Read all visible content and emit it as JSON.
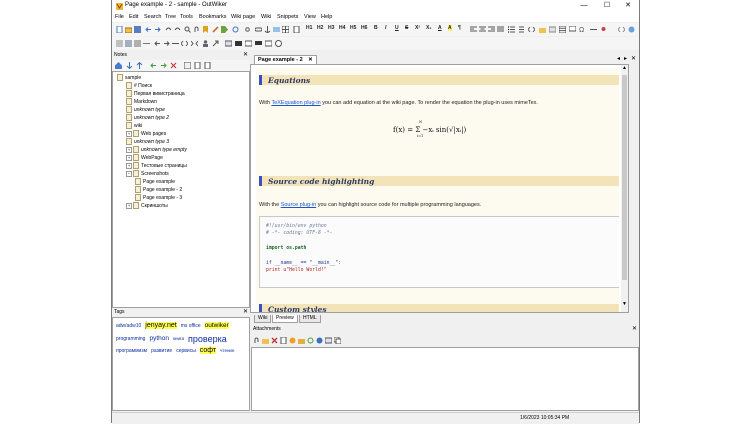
{
  "window": {
    "title": "Page example - 2 - sample - OutWiker",
    "buttons": [
      "—",
      "☐",
      "✕"
    ]
  },
  "menu": [
    "File",
    "Edit",
    "Search",
    "Tree",
    "Tools",
    "Bookmarks",
    "Wiki page",
    "Wiki",
    "Snippets",
    "View",
    "Help"
  ],
  "toolbar": {
    "format_buttons": [
      "H1",
      "H2",
      "H3",
      "H4",
      "H5",
      "H6",
      "B",
      "I",
      "U",
      "S",
      "X²",
      "X₂",
      "A",
      "A",
      "¶"
    ]
  },
  "notes_panel": {
    "title": "Notes",
    "tree": [
      {
        "label": "sample",
        "level": 0,
        "italic": false,
        "expander": ""
      },
      {
        "label": "# Поиск",
        "level": 1,
        "italic": false,
        "expander": ""
      },
      {
        "label": "Первая викистраница",
        "level": 1,
        "italic": false,
        "expander": ""
      },
      {
        "label": "Markdown",
        "level": 1,
        "italic": false,
        "expander": ""
      },
      {
        "label": "unknown type",
        "level": 1,
        "italic": true,
        "expander": ""
      },
      {
        "label": "unknown type 2",
        "level": 1,
        "italic": true,
        "expander": ""
      },
      {
        "label": "wiki",
        "level": 1,
        "italic": false,
        "expander": ""
      },
      {
        "label": "Web pages",
        "level": 1,
        "italic": false,
        "expander": "+"
      },
      {
        "label": "unknown type 3",
        "level": 1,
        "italic": true,
        "expander": ""
      },
      {
        "label": "unknown type empty",
        "level": 1,
        "italic": true,
        "expander": "+"
      },
      {
        "label": "WebPage",
        "level": 1,
        "italic": false,
        "expander": "+"
      },
      {
        "label": "Тестовые страницы",
        "level": 1,
        "italic": false,
        "expander": "+"
      },
      {
        "label": "Screenshots",
        "level": 1,
        "italic": false,
        "expander": "−"
      },
      {
        "label": "Page example",
        "level": 2,
        "italic": false,
        "expander": ""
      },
      {
        "label": "Page example - 2",
        "level": 2,
        "italic": false,
        "expander": ""
      },
      {
        "label": "Page example - 3",
        "level": 2,
        "italic": false,
        "expander": ""
      },
      {
        "label": "Скриншоты",
        "level": 1,
        "italic": false,
        "expander": "+"
      }
    ]
  },
  "tags_panel": {
    "title": "Tags",
    "tags": [
      {
        "text": "adw/adw10",
        "size": 5,
        "hl": false,
        "row": 0
      },
      {
        "text": "jenyay.net",
        "size": 7,
        "hl": true,
        "row": 0
      },
      {
        "text": "ms office",
        "size": 5,
        "hl": false,
        "row": 0
      },
      {
        "text": "outwiker",
        "size": 6.5,
        "hl": true,
        "row": 0
      },
      {
        "text": "programming",
        "size": 5,
        "hl": false,
        "row": 1
      },
      {
        "text": "python",
        "size": 6.5,
        "hl": false,
        "row": 1
      },
      {
        "text": "книга",
        "size": 4.5,
        "hl": false,
        "row": 1
      },
      {
        "text": "проверка",
        "size": 9,
        "hl": false,
        "row": 1
      },
      {
        "text": "программизм",
        "size": 5,
        "hl": false,
        "row": 2
      },
      {
        "text": "развитие",
        "size": 5,
        "hl": false,
        "row": 2
      },
      {
        "text": "сервисы",
        "size": 5,
        "hl": false,
        "row": 2
      },
      {
        "text": "софт",
        "size": 7,
        "hl": true,
        "row": 2
      },
      {
        "text": "чтение",
        "size": 4.5,
        "hl": false,
        "row": 2
      }
    ]
  },
  "editor": {
    "tab_label": "Page example - 2",
    "tab_close": "✕",
    "sections": {
      "equations_title": "Equations",
      "equations_text_before": "With ",
      "equations_link": "TeXEquation plug-in",
      "equations_text_after": " you can add equation at the wiki page. To render the equation the plug-in uses mimeTex.",
      "formula": "f(x) = Σ −xᵢ sin(√|xᵢ|)",
      "formula_sum_top": "N",
      "formula_sum_bottom": "i=1",
      "source_title": "Source code highlighting",
      "source_text_before": "With the ",
      "source_link": "Source plug-in",
      "source_text_after": " you can highlight source code for multiple programming languages.",
      "code_lines": [
        "#!/usr/bin/env python",
        "# -*- coding: UTF-8 -*-",
        "",
        "import os.path",
        "",
        "if __name__ == \"__main__\":",
        "    print u\"Hello World!\""
      ],
      "custom_title": "Custom styles"
    },
    "bottom_tabs": [
      "Wiki",
      "Preview",
      "HTML"
    ]
  },
  "attachments_panel": {
    "title": "Attachments"
  },
  "status": {
    "datetime": "1/6/2023 10:05:34 PM"
  },
  "colors": {
    "header_bg": "#f2e3b8",
    "header_bar": "#3b4fbf",
    "link": "#1a55d0",
    "tag_highlight": "#ffff55"
  }
}
